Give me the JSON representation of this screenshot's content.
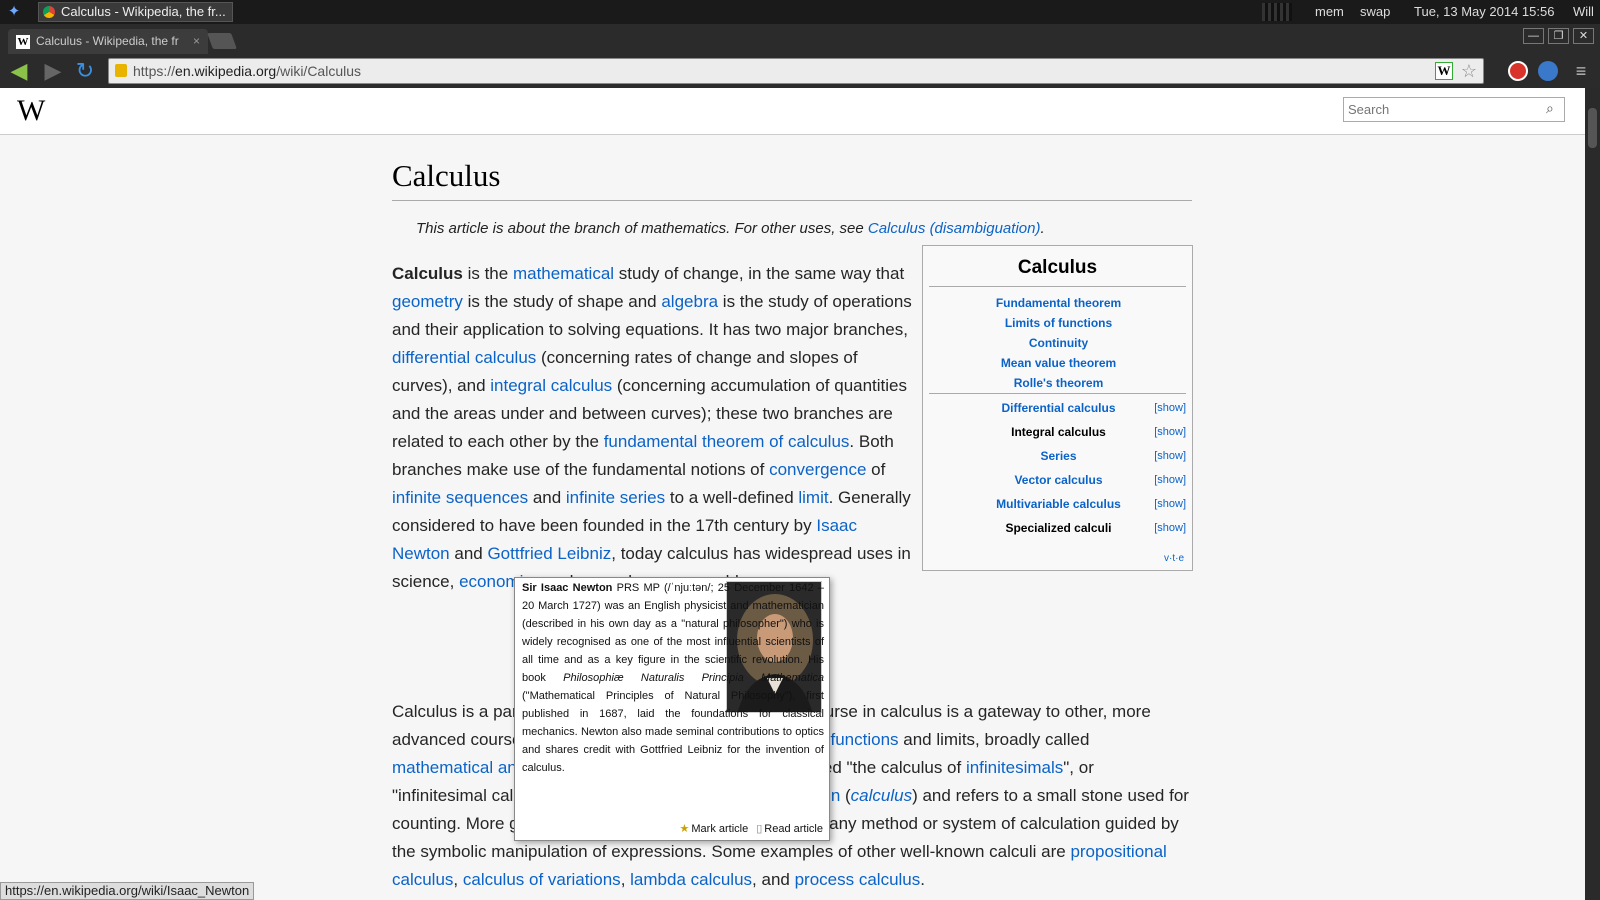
{
  "os": {
    "task_title": "Calculus - Wikipedia, the fr...",
    "mem": "mem",
    "swap": "swap",
    "clock": "Tue, 13 May 2014 15:56",
    "user": "Will"
  },
  "browser": {
    "tab_title": "Calculus - Wikipedia, the fr",
    "tab_close": "×",
    "url_prefix": "https://",
    "url_host": "en.wikipedia.org",
    "url_path": "/wiki/Calculus",
    "status_url": "https://en.wikipedia.org/wiki/Isaac_Newton"
  },
  "wiki": {
    "search_placeholder": "Search",
    "title": "Calculus",
    "hatnote_text": "This article is about the branch of mathematics. For other uses, see ",
    "hatnote_link": "Calculus (disambiguation)",
    "hatnote_end": "."
  },
  "navbox": {
    "title": "Calculus",
    "links": [
      "Fundamental theorem",
      "Limits of functions",
      "Continuity",
      "Mean value theorem",
      "Rolle's theorem"
    ],
    "sections": [
      {
        "name": "Differential calculus",
        "show": "[show]"
      },
      {
        "name": "Integral calculus",
        "show": "[show]"
      },
      {
        "name": "Series",
        "show": "[show]"
      },
      {
        "name": "Vector calculus",
        "show": "[show]"
      },
      {
        "name": "Multivariable calculus",
        "show": "[show]"
      },
      {
        "name": "Specialized calculi",
        "show": "[show]"
      }
    ],
    "vte": "v·t·e"
  },
  "popup": {
    "name": "Sir Isaac Newton",
    "postnominal": " PRS MP (/ˈnjuːtən/; 25 December 1642 – 20 March 1727) was an English physicist and mathematician (described in his own day as a \"natural philosopher\") who is widely recognised as one of the most influential scientists of all time and as a key figure in the scientific revolution. His book ",
    "book": "Philosophiæ Naturalis Principia Mathematica",
    "rest": " (\"Mathematical Principles of Natural Philosophy\"), first published in 1687, laid the foundations for classical mechanics. Newton also made seminal contributions to optics and shares credit with Gottfried Leibniz for the invention of calculus.",
    "mark": "Mark article",
    "read": "Read article"
  }
}
